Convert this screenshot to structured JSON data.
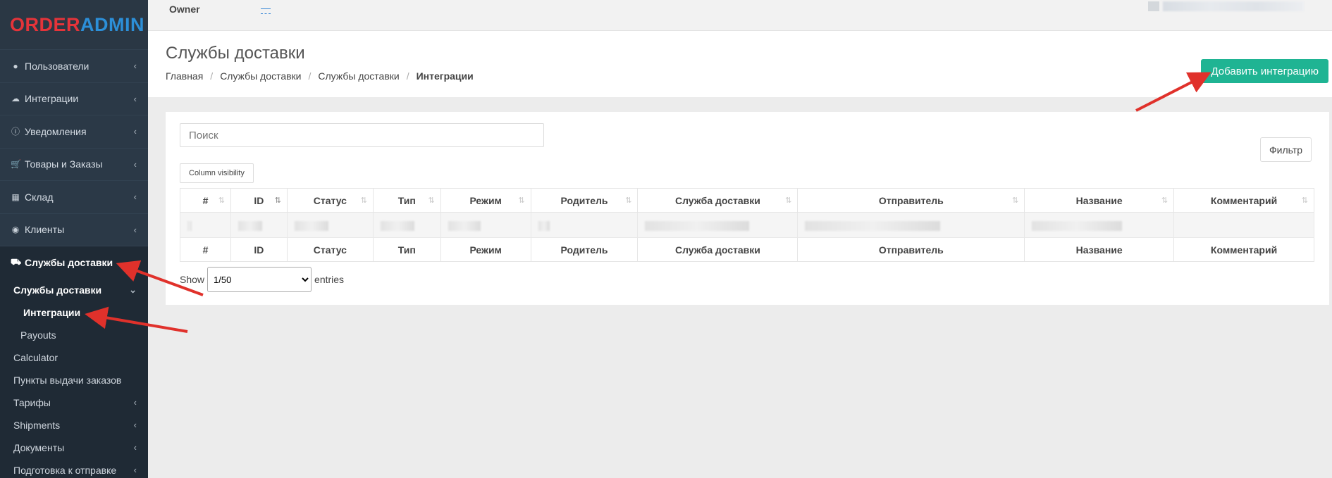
{
  "logo": {
    "part1": "ORDER",
    "part2": "ADMIN"
  },
  "topbar": {
    "owner_label": "Owner",
    "owner_value": "—"
  },
  "sidebar": {
    "items": [
      {
        "label": "Пользователи",
        "icon": "user-icon"
      },
      {
        "label": "Интеграции",
        "icon": "cloud-icon"
      },
      {
        "label": "Уведомления",
        "icon": "info-icon"
      },
      {
        "label": "Товары и Заказы",
        "icon": "cart-icon"
      },
      {
        "label": "Склад",
        "icon": "cubes-icon"
      },
      {
        "label": "Клиенты",
        "icon": "users-icon"
      },
      {
        "label": "Службы доставки",
        "icon": "truck-icon"
      }
    ],
    "sub": {
      "group": "Службы доставки",
      "integrations": "Интеграции",
      "payouts": "Payouts",
      "calculator": "Calculator",
      "pickup_points": "Пункты выдачи заказов",
      "tariffs": "Тарифы",
      "shipments": "Shipments",
      "documents": "Документы",
      "prep": "Подготовка к отправке"
    }
  },
  "header": {
    "title": "Службы доставки",
    "breadcrumb": [
      "Главная",
      "Службы доставки",
      "Службы доставки",
      "Интеграции"
    ],
    "add_button": "Добавить интеграцию"
  },
  "content": {
    "search_placeholder": "Поиск",
    "filter_button": "Фильтр",
    "column_visibility": "Column visibility",
    "columns": [
      "#",
      "ID",
      "Статус",
      "Тип",
      "Режим",
      "Родитель",
      "Служба доставки",
      "Отправитель",
      "Название",
      "Комментарий"
    ],
    "show_label": "Show",
    "page_size": "1/50",
    "entries_label": "entries"
  },
  "colors": {
    "sidebar_bg": "#2b3947",
    "accent_green": "#1fb493",
    "arrow_red": "#e0312b"
  }
}
